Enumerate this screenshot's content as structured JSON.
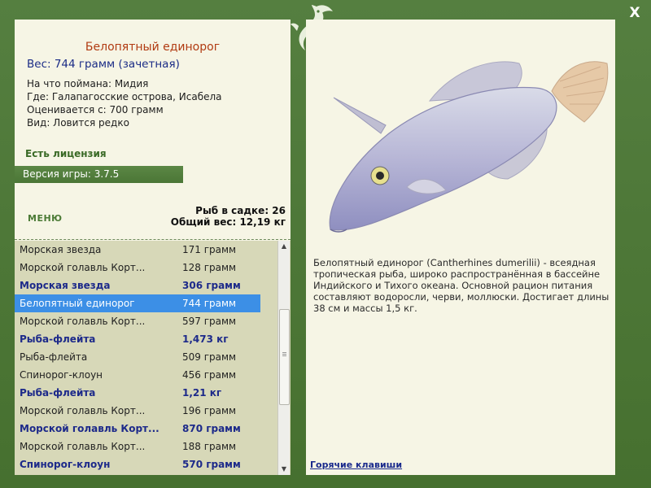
{
  "window": {
    "close_label": "X"
  },
  "fish_detail": {
    "title": "Белопятный единорог",
    "weight_line": "Вес: 744 грамм (зачетная)",
    "bait_line": "На что поймана: Мидия",
    "place_line": "Где: Галапагосские острова, Исабела",
    "rated_line": "Оценивается с: 700 грамм",
    "kind_line": "Вид: Ловится редко"
  },
  "license_text": "Есть лицензия",
  "version_text": "Версия игры: 3.7.5",
  "menu_label": "МЕНЮ",
  "stats": {
    "count_line": "Рыб в садке: 26",
    "total_line": "Общий вес: 12,19 кг"
  },
  "catch_list": [
    {
      "name": "Морская звезда",
      "weight": "171 грамм",
      "trophy": false,
      "selected": false
    },
    {
      "name": "Морской голавль Корт...",
      "weight": "128 грамм",
      "trophy": false,
      "selected": false
    },
    {
      "name": "Морская звезда",
      "weight": "306 грамм",
      "trophy": true,
      "selected": false
    },
    {
      "name": "Белопятный единорог",
      "weight": "744 грамм",
      "trophy": true,
      "selected": true
    },
    {
      "name": "Морской голавль Корт...",
      "weight": "597 грамм",
      "trophy": false,
      "selected": false
    },
    {
      "name": "Рыба-флейта",
      "weight": "1,473 кг",
      "trophy": true,
      "selected": false
    },
    {
      "name": "Рыба-флейта",
      "weight": "509 грамм",
      "trophy": false,
      "selected": false
    },
    {
      "name": "Спинорог-клоун",
      "weight": "456 грамм",
      "trophy": false,
      "selected": false
    },
    {
      "name": "Рыба-флейта",
      "weight": "1,21 кг",
      "trophy": true,
      "selected": false
    },
    {
      "name": "Морской голавль Корт...",
      "weight": "196 грамм",
      "trophy": false,
      "selected": false
    },
    {
      "name": "Морской голавль Корт...",
      "weight": "870 грамм",
      "trophy": true,
      "selected": false
    },
    {
      "name": "Морской голавль Корт...",
      "weight": "188 грамм",
      "trophy": false,
      "selected": false
    },
    {
      "name": "Спинорог-клоун",
      "weight": "570 грамм",
      "trophy": true,
      "selected": false
    }
  ],
  "description": "Белопятный единорог (Cantherhines dumerilii) - всеядная тропическая рыба, широко распространённая в бассейне Индийского и Тихого океана. Основной рацион питания составляют водоросли, черви, моллюски. Достигает длины 38 см и массы 1,5 кг.",
  "hotkeys_label": "Горячие клавиши",
  "colors": {
    "frame_green": "#4e7a3b",
    "panel_bg": "#f6f5e5",
    "list_bg": "#d7d8b8",
    "selection_blue": "#3c8fe6",
    "trophy_blue": "#1d2a8a",
    "title_red": "#b13b12"
  },
  "icons": {
    "logo": "leaping-fish-logo-icon",
    "close": "close-icon"
  }
}
